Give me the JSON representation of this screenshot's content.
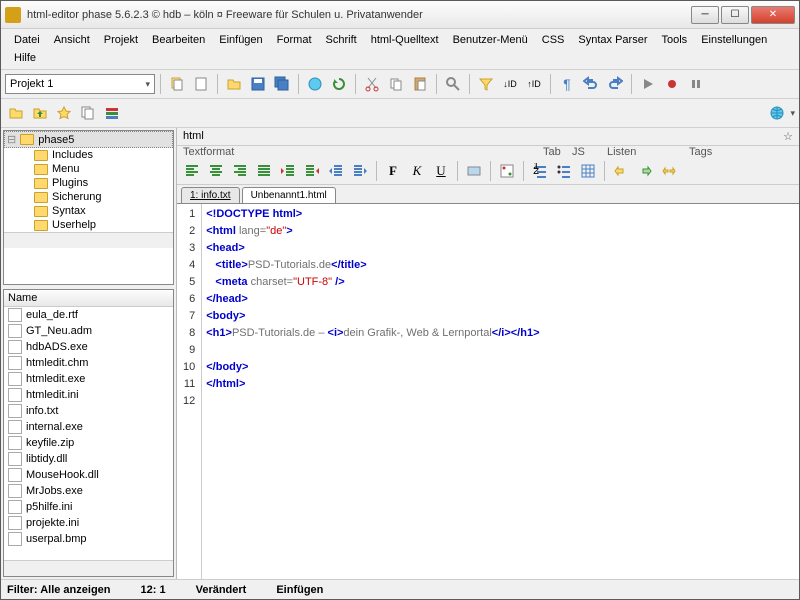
{
  "window": {
    "title": "html-editor phase 5.6.2.3  ©  hdb – köln  ¤  Freeware für Schulen u. Privatanwender"
  },
  "menu": [
    "Datei",
    "Ansicht",
    "Projekt",
    "Bearbeiten",
    "Einfügen",
    "Format",
    "Schrift",
    "html-Quelltext",
    "Benutzer-Menü",
    "CSS",
    "Syntax Parser",
    "Tools",
    "Einstellungen",
    "Hilfe"
  ],
  "project_combo": "Projekt 1",
  "breadcrumb": "html",
  "format_groups": {
    "textformat": "Textformat",
    "tab": "Tab",
    "js": "JS",
    "listen": "Listen",
    "tags": "Tags"
  },
  "tree": {
    "root": "phase5",
    "children": [
      "Includes",
      "Menu",
      "Plugins",
      "Sicherung",
      "Syntax",
      "Userhelp"
    ]
  },
  "file_header": "Name",
  "files": [
    "eula_de.rtf",
    "GT_Neu.adm",
    "hdbADS.exe",
    "htmledit.chm",
    "htmledit.exe",
    "htmledit.ini",
    "info.txt",
    "internal.exe",
    "keyfile.zip",
    "libtidy.dll",
    "MouseHook.dll",
    "MrJobs.exe",
    "p5hilfe.ini",
    "projekte.ini",
    "userpal.bmp"
  ],
  "tabs": [
    {
      "label": "1: info.txt",
      "active": false
    },
    {
      "label": "Unbenannt1.html",
      "active": true
    }
  ],
  "code": [
    {
      "n": 1,
      "tokens": [
        [
          "kw",
          "<!DOCTYPE html>"
        ]
      ]
    },
    {
      "n": 2,
      "tokens": [
        [
          "kw",
          "<html "
        ],
        [
          "txt",
          "lang="
        ],
        [
          "str",
          "\"de\""
        ],
        [
          "kw",
          ">"
        ]
      ]
    },
    {
      "n": 3,
      "tokens": [
        [
          "kw",
          "<head>"
        ]
      ]
    },
    {
      "n": 4,
      "tokens": [
        [
          "",
          "   "
        ],
        [
          "kw",
          "<title>"
        ],
        [
          "txt",
          "PSD-Tutorials.de"
        ],
        [
          "kw",
          "</title>"
        ]
      ]
    },
    {
      "n": 5,
      "tokens": [
        [
          "",
          "   "
        ],
        [
          "kw",
          "<meta "
        ],
        [
          "txt",
          "charset="
        ],
        [
          "str",
          "\"UTF-8\""
        ],
        [
          "kw",
          " />"
        ]
      ]
    },
    {
      "n": 6,
      "tokens": [
        [
          "kw",
          "</head>"
        ]
      ]
    },
    {
      "n": 7,
      "tokens": [
        [
          "kw",
          "<body>"
        ]
      ]
    },
    {
      "n": 8,
      "tokens": [
        [
          "kw",
          "<h1>"
        ],
        [
          "txt",
          "PSD-Tutorials.de – "
        ],
        [
          "kw",
          "<i>"
        ],
        [
          "txt",
          "dein Grafik-, Web & Lernportal"
        ],
        [
          "kw",
          "</i></h1>"
        ]
      ]
    },
    {
      "n": 9,
      "tokens": [
        [
          "",
          ""
        ]
      ]
    },
    {
      "n": 10,
      "tokens": [
        [
          "kw",
          "</body>"
        ]
      ]
    },
    {
      "n": 11,
      "tokens": [
        [
          "kw",
          "</html>"
        ]
      ]
    },
    {
      "n": 12,
      "tokens": [
        [
          "",
          ""
        ]
      ]
    }
  ],
  "status": {
    "filter": "Filter: Alle anzeigen",
    "pos": "12: 1",
    "modified": "Verändert",
    "mode": "Einfügen"
  }
}
